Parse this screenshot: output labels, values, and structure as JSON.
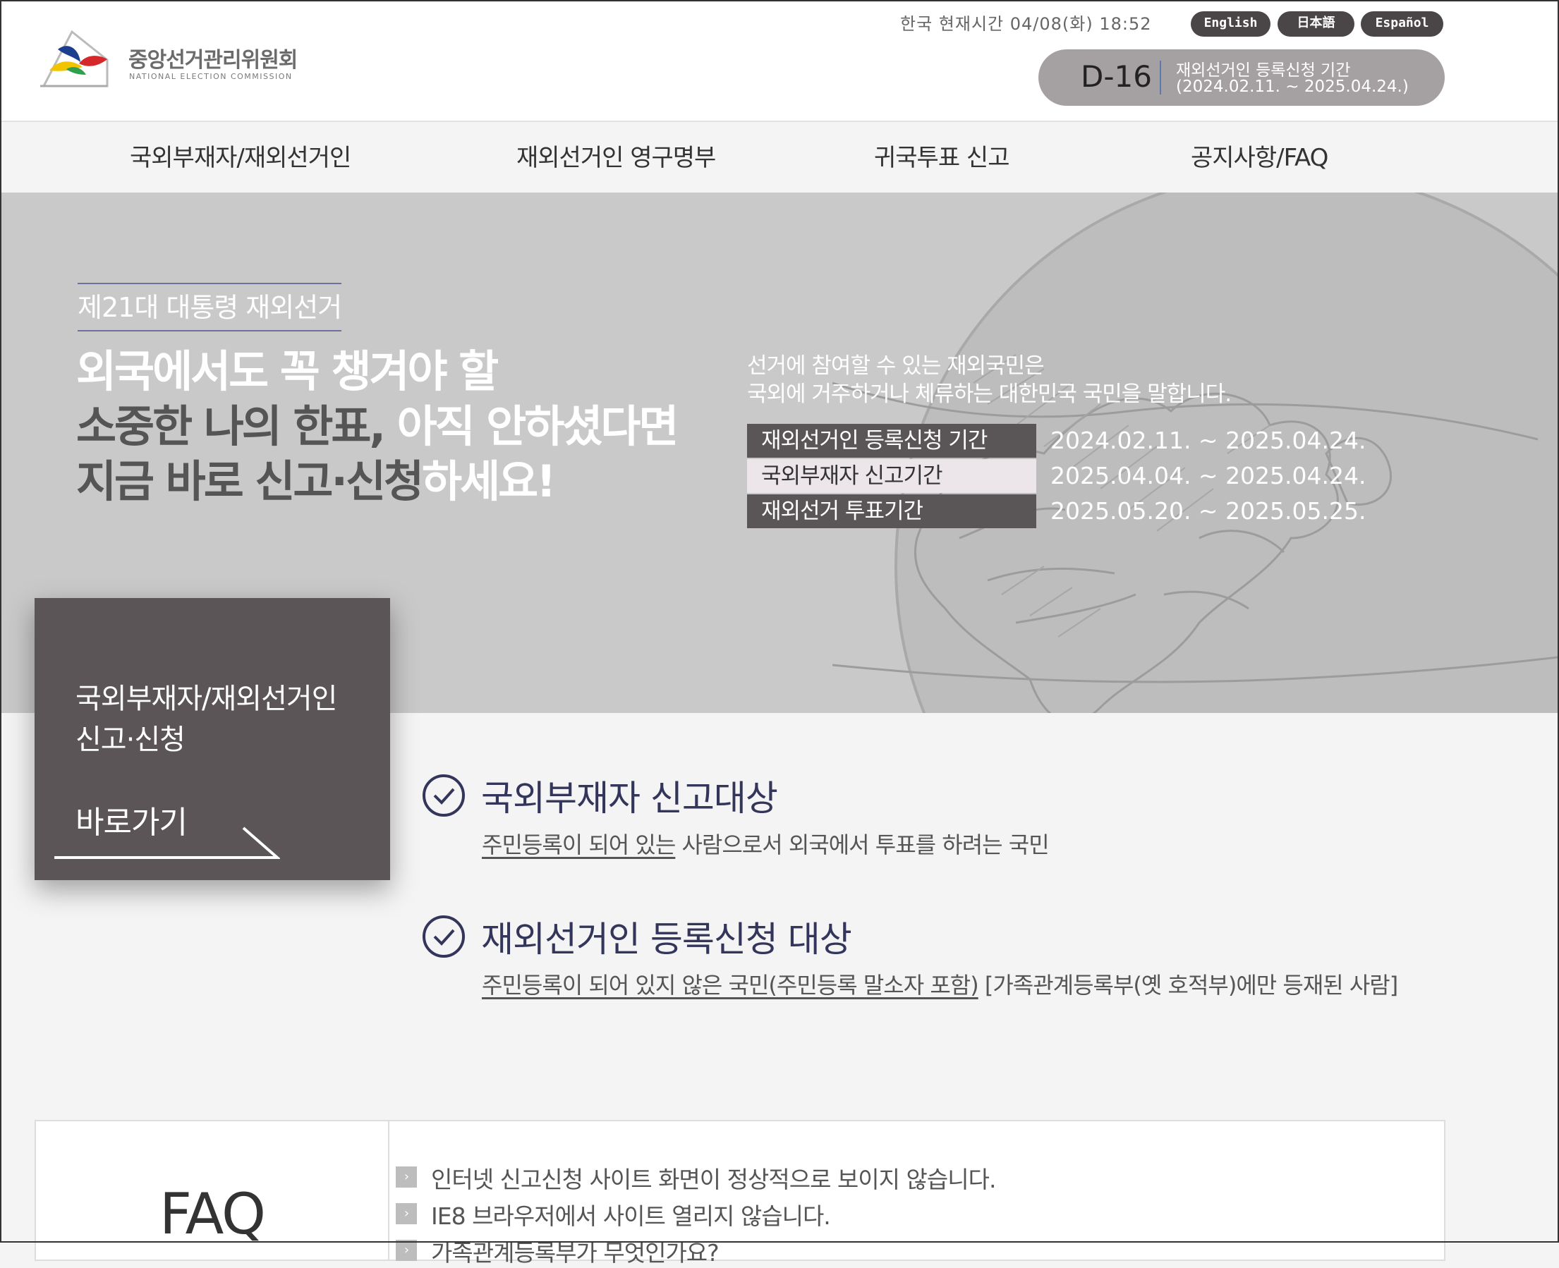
{
  "header": {
    "logo": {
      "ko": "중앙선거관리위원회",
      "en": "NATIONAL ELECTION COMMISSION"
    },
    "current_time": "한국 현재시간 04/08(화) 18:52",
    "languages": [
      "English",
      "日本語",
      "Español"
    ],
    "dday": {
      "count": "D-16",
      "line1": "재외선거인 등록신청 기간",
      "line2": "(2024.02.11. ~ 2025.04.24.)"
    }
  },
  "nav": [
    "국외부재자/재외선거인",
    "재외선거인 영구명부",
    "귀국투표 신고",
    "공지사항/FAQ"
  ],
  "hero": {
    "eyebrow": "제21대 대통령 재외선거",
    "headline": {
      "line1": "외국에서도 꼭 챙겨야 할",
      "line2_dark": "소중한 나의 한표,",
      "line2_rest": " 아직 안하셨다면",
      "line3_dark": "지금 바로 신고·신청",
      "line3_rest": "하세요!"
    },
    "desc_line1": "선거에 참여할 수 있는 재외국민은",
    "desc_line2": "국외에 거주하거나 체류하는 대한민국 국민을 말합니다.",
    "periods": [
      {
        "label": "재외선거인 등록신청 기간",
        "date": "2024.02.11. ~ 2025.04.24."
      },
      {
        "label": "국외부재자 신고기간",
        "date": "2025.04.04. ~ 2025.04.24."
      },
      {
        "label": "재외선거 투표기간",
        "date": "2025.05.20. ~ 2025.05.25."
      }
    ]
  },
  "quick_card": {
    "line1": "국외부재자/재외선거인",
    "line2": "신고·신청",
    "go": "바로가기"
  },
  "eligibility": [
    {
      "title": "국외부재자 신고대상",
      "desc_underlined": "주민등록이 되어 있는",
      "desc_rest": " 사람으로서 외국에서 투표를 하려는 국민"
    },
    {
      "title": "재외선거인 등록신청 대상",
      "desc_underlined": "주민등록이 되어 있지 않은 국민(주민등록 말소자 포함)",
      "desc_rest": " [가족관계등록부(옛 호적부)에만 등재된 사람]"
    }
  ],
  "faq": {
    "title": "FAQ",
    "items": [
      "인터넷 신고신청 사이트 화면이 정상적으로 보이지 않습니다.",
      "IE8 브라우저에서 사이트 열리지 않습니다.",
      "가족관계등록부가 무엇인가요?"
    ]
  },
  "colors": {
    "header_bg": "#ffffff",
    "hero_bg": "#c9c9c9",
    "card_bg": "#5b5557",
    "accent_navy": "#34355a",
    "lang_pill": "#4a4547"
  }
}
